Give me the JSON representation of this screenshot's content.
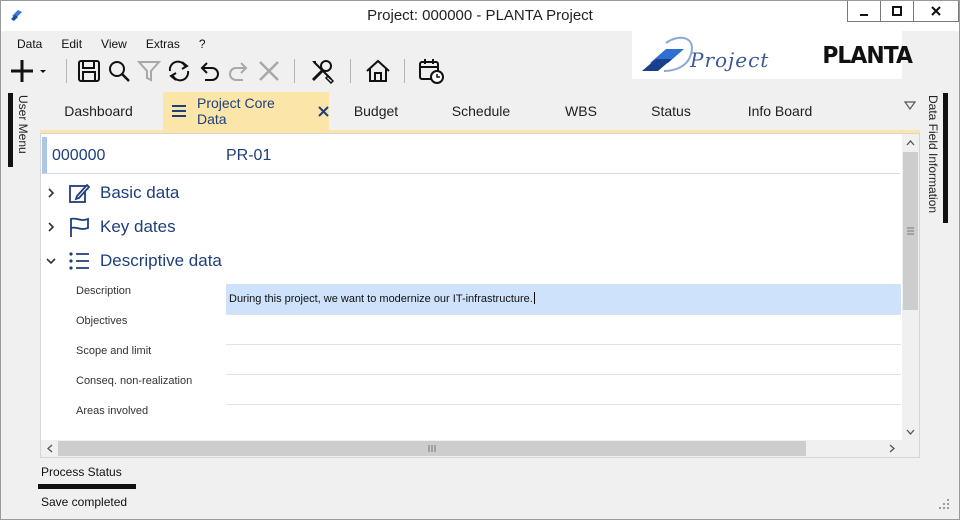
{
  "window": {
    "title": "Project: 000000 - PLANTA Project"
  },
  "menu": [
    "Data",
    "Edit",
    "View",
    "Extras",
    "?"
  ],
  "toolbar": {
    "icons": [
      "add-icon",
      "save-icon",
      "search-icon",
      "filter-icon",
      "refresh-icon",
      "undo-icon",
      "redo-icon",
      "delete-icon",
      "tools-icon",
      "home-icon",
      "calendar-icon"
    ]
  },
  "logos": {
    "project_text": "Project",
    "planta_text": "PLANTA"
  },
  "side": {
    "left_label": "User Menu",
    "right_label": "Data Field Information"
  },
  "tabs": [
    {
      "label": "Dashboard"
    },
    {
      "label": "Project Core Data",
      "active": true
    },
    {
      "label": "Budget"
    },
    {
      "label": "Schedule"
    },
    {
      "label": "WBS"
    },
    {
      "label": "Status"
    },
    {
      "label": "Info Board"
    }
  ],
  "record": {
    "id": "000000",
    "code": "PR-01"
  },
  "sections": [
    {
      "label": "Basic data",
      "expanded": false,
      "icon": "edit-icon"
    },
    {
      "label": "Key dates",
      "expanded": false,
      "icon": "flag-icon"
    },
    {
      "label": "Descriptive data",
      "expanded": true,
      "icon": "list-icon"
    }
  ],
  "fields": [
    {
      "label": "Description",
      "value": "During this project, we want to modernize our IT-infrastructure."
    },
    {
      "label": "Objectives",
      "value": ""
    },
    {
      "label": "Scope and limit",
      "value": ""
    },
    {
      "label": "Conseq. non-realization",
      "value": ""
    },
    {
      "label": "Areas involved",
      "value": ""
    }
  ],
  "status": {
    "process_label": "Process Status",
    "message": "Save completed"
  },
  "colors": {
    "accent_tab": "#fce5a9",
    "text_blue": "#1e3f7a",
    "selected_row": "#cfe2fb"
  }
}
